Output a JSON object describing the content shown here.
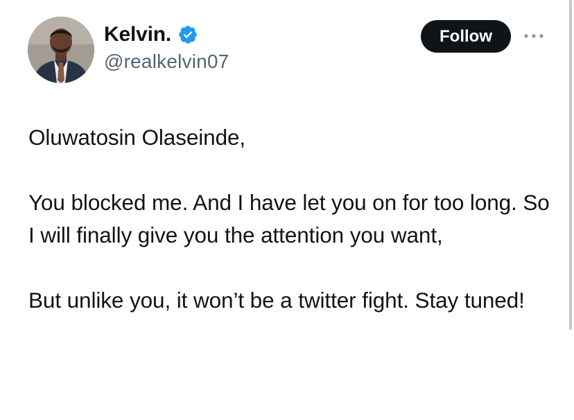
{
  "author": {
    "display_name": "Kelvin.",
    "handle": "@realkelvin07",
    "verified_icon": "verified-badge-icon",
    "avatar_icon": "profile-photo"
  },
  "actions": {
    "follow_label": "Follow",
    "more_icon": "more-horizontal-icon"
  },
  "tweet": {
    "paragraphs": [
      "Oluwatosin Olaseinde,",
      "You blocked me. And I have let you on for too long. So I will finally give you the attention you want,",
      "But unlike you, it won’t be a twitter fight. Stay tuned!"
    ]
  },
  "colors": {
    "text": "#0f1419",
    "secondary_text": "#536471",
    "verified_blue": "#1d9bf0",
    "button_bg": "#0f1419",
    "button_text": "#ffffff"
  }
}
